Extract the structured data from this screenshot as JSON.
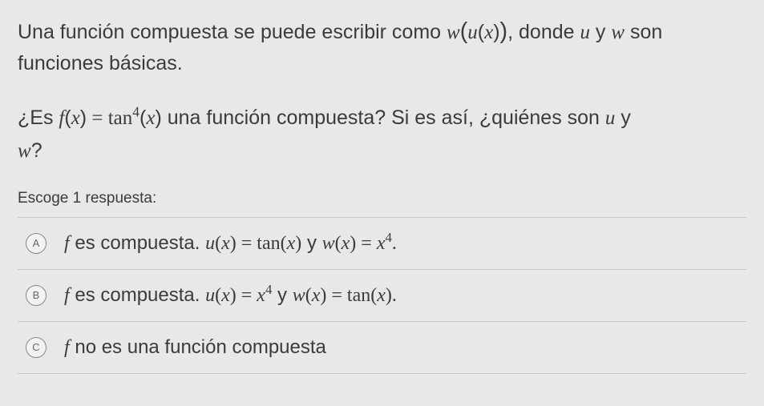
{
  "intro": {
    "part1": "Una función compuesta se puede escribir como ",
    "expr_w": "w",
    "expr_u": "u",
    "expr_x": "x",
    "part2": ", donde ",
    "and": " y ",
    "part3": " son funciones básicas."
  },
  "question": {
    "q1": "¿Es ",
    "fx": "f",
    "eq": " = ",
    "tan": "tan",
    "exp4": "4",
    "q2": " una función compuesta? Si es así, ¿quiénes son ",
    "q3": "?"
  },
  "prompt": "Escoge 1 respuesta:",
  "options": {
    "A": {
      "letter": "A",
      "pre": "f",
      "text1": " es compuesta. ",
      "u": "u",
      "x": "x",
      "eq": " = ",
      "tan": "tan",
      "and": " y ",
      "w": "w",
      "x4exp": "4",
      "dot": "."
    },
    "B": {
      "letter": "B",
      "pre": "f",
      "text1": " es compuesta. ",
      "u": "u",
      "x": "x",
      "eq": " = ",
      "x4exp": "4",
      "and": " y ",
      "w": "w",
      "tan": "tan",
      "dot": "."
    },
    "C": {
      "letter": "C",
      "pre": "f",
      "text1": " no es una función compuesta"
    }
  }
}
